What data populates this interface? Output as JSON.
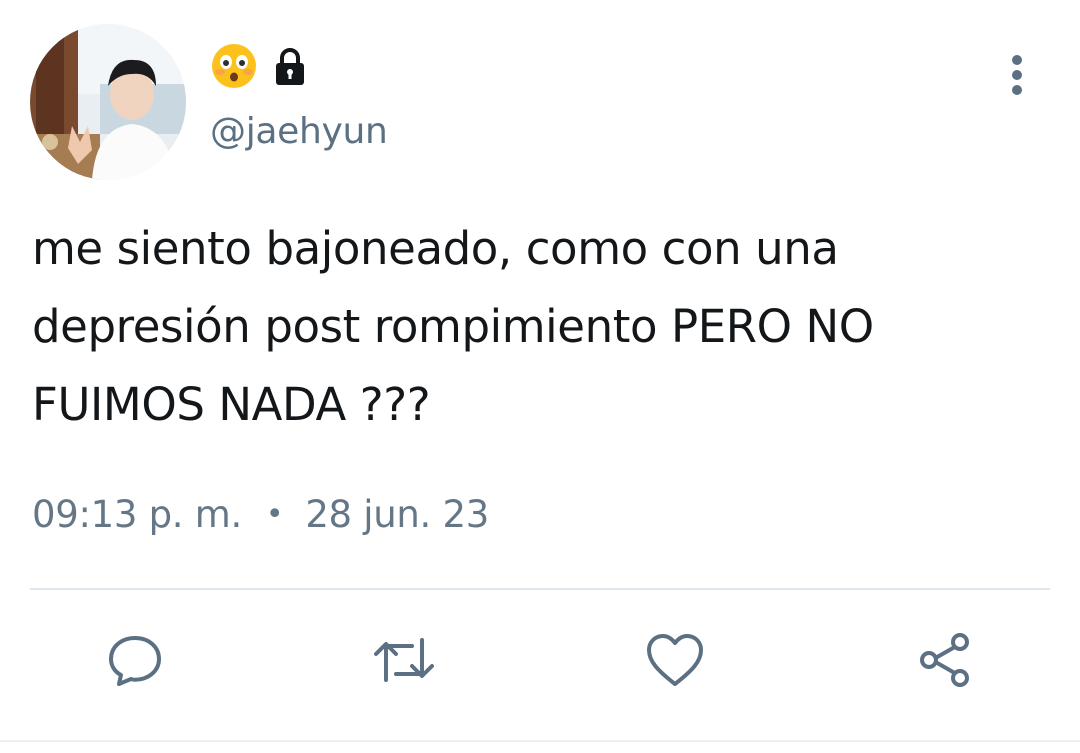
{
  "author": {
    "handle": "@jaehyun",
    "name_emoji_icons": [
      "flushed-face-emoji",
      "lock-icon"
    ],
    "avatar": "profile-photo"
  },
  "tweet": {
    "text_lines": [
      "me siento bajoneado, como con una",
      "depresión post rompimiento PERO NO",
      "FUIMOS NADA ???"
    ],
    "time": "09:13 p. m.",
    "separator": "•",
    "date": "28 jun. 23"
  },
  "actions": [
    "reply-icon",
    "retweet-icon",
    "like-icon",
    "share-icon"
  ],
  "colors": {
    "text": "#14171a",
    "secondary": "#657786",
    "icon": "#5b7083",
    "divider": "#e1e8ed"
  }
}
